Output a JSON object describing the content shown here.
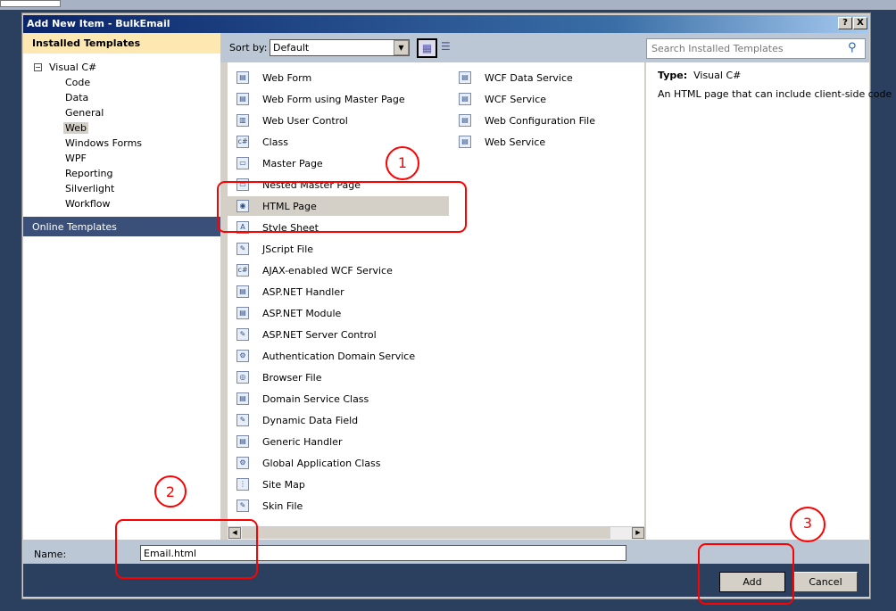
{
  "window": {
    "title": "Add New Item - BulkEmail",
    "help_label": "?",
    "close_label": "X"
  },
  "left": {
    "header": "Installed Templates",
    "root": "Visual C#",
    "root_toggle": "−",
    "children": [
      "Code",
      "Data",
      "General",
      "Web",
      "Windows Forms",
      "WPF",
      "Reporting",
      "Silverlight",
      "Workflow"
    ],
    "selected": "Web",
    "online": "Online Templates"
  },
  "toolbar": {
    "sort_label": "Sort by:",
    "sort_value": "Default",
    "search_placeholder": "Search Installed Templates"
  },
  "templates": {
    "col1": [
      "Web Form",
      "Web Form using Master Page",
      "Web User Control",
      "Class",
      "Master Page",
      "Nested Master Page",
      "HTML Page",
      "Style Sheet",
      "JScript File",
      "AJAX-enabled WCF Service",
      "ASP.NET Handler",
      "ASP.NET Module",
      "ASP.NET Server Control",
      "Authentication Domain Service",
      "Browser File",
      "Domain Service Class",
      "Dynamic Data Field",
      "Generic Handler",
      "Global Application Class",
      "Site Map",
      "Skin File"
    ],
    "col2": [
      "WCF Data Service",
      "WCF Service",
      "Web Configuration File",
      "Web Service"
    ],
    "selected": "HTML Page"
  },
  "details": {
    "type_label": "Type:",
    "type_value": "Visual C#",
    "description": "An HTML page that can include client-side code"
  },
  "name": {
    "label": "Name:",
    "value": "Email.html"
  },
  "buttons": {
    "add": "Add",
    "cancel": "Cancel"
  },
  "annotations": [
    "1",
    "2",
    "3"
  ],
  "colors": {
    "annotation": "#ff0000",
    "title_start": "#0a246a",
    "header_band": "#bcc7d6",
    "installed_bg": "#fde8b2",
    "selected_row": "#d4d0c8"
  }
}
